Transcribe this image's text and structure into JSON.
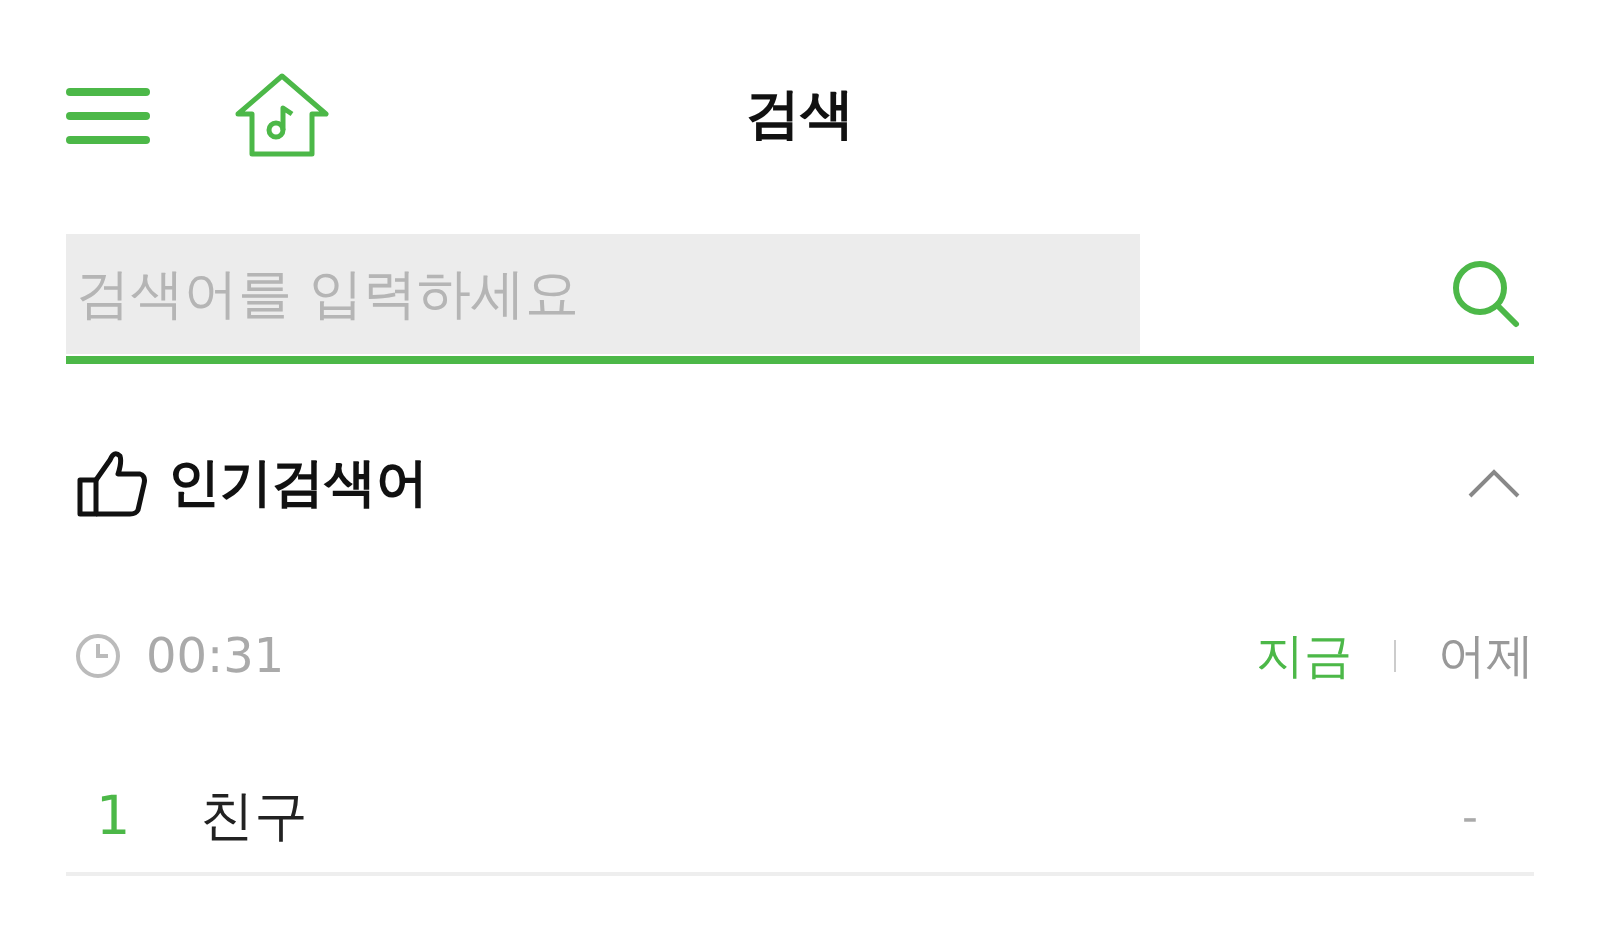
{
  "header": {
    "title": "검색"
  },
  "search": {
    "placeholder": "검색어를 입력하세요"
  },
  "popular": {
    "title": "인기검색어",
    "expanded": true,
    "time": "00:31",
    "tabs": [
      {
        "label": "지금",
        "selected": true
      },
      {
        "label": "어제",
        "selected": false
      }
    ],
    "rows": [
      {
        "rank": "1",
        "term": "친구",
        "change": "-"
      }
    ]
  }
}
